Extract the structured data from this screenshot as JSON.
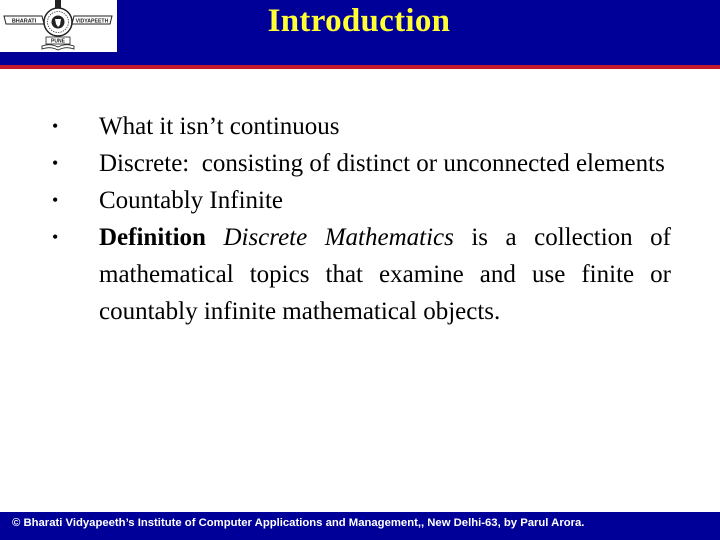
{
  "header": {
    "title": "Introduction",
    "logo": {
      "left_text": "BHARATI",
      "right_text": "VIDYAPEETH",
      "bottom_text": "PUNE",
      "icon": "emblem-logo-icon"
    },
    "colors": {
      "band": "#000099",
      "title": "#ffff33",
      "rule": "#c01a2c"
    }
  },
  "bullets": [
    {
      "marker": "•",
      "text": "What it isn’t continuous"
    },
    {
      "marker": "•",
      "text": "Discrete:  consisting of distinct or unconnected elements"
    },
    {
      "marker": "•",
      "text": "Countably Infinite"
    },
    {
      "marker": "•",
      "bold": "Definition",
      "italic": "Discrete Mathematics",
      "rest": " is a collection of mathematical topics that examine and use finite or countably infinite mathematical objects."
    }
  ],
  "footer": {
    "text": "© Bharati Vidyapeeth’s Institute of Computer Applications and Management,, New Delhi-63, by Parul Arora."
  }
}
